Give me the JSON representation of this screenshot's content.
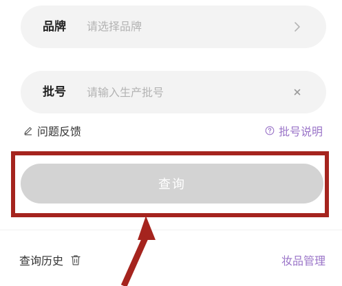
{
  "brand_field": {
    "label": "品牌",
    "placeholder": "请选择品牌",
    "icon": "chevron-right-icon"
  },
  "batch_field": {
    "label": "批号",
    "placeholder": "请输入生产批号",
    "value": "",
    "icon": "clear-icon"
  },
  "links": {
    "feedback": "问题反馈",
    "feedback_icon": "pencil-icon",
    "batch_help": "批号说明",
    "batch_help_icon": "question-circle-icon"
  },
  "query_button": {
    "label": "查询",
    "state": "disabled"
  },
  "history": {
    "title": "查询历史",
    "icon": "trash-icon"
  },
  "manage_link": "妆品管理",
  "colors": {
    "field_bg": "#f3f3f3",
    "accent_purple": "#9a74c8",
    "button_disabled": "#d3d3d3",
    "annotation_red": "#a5241e"
  }
}
